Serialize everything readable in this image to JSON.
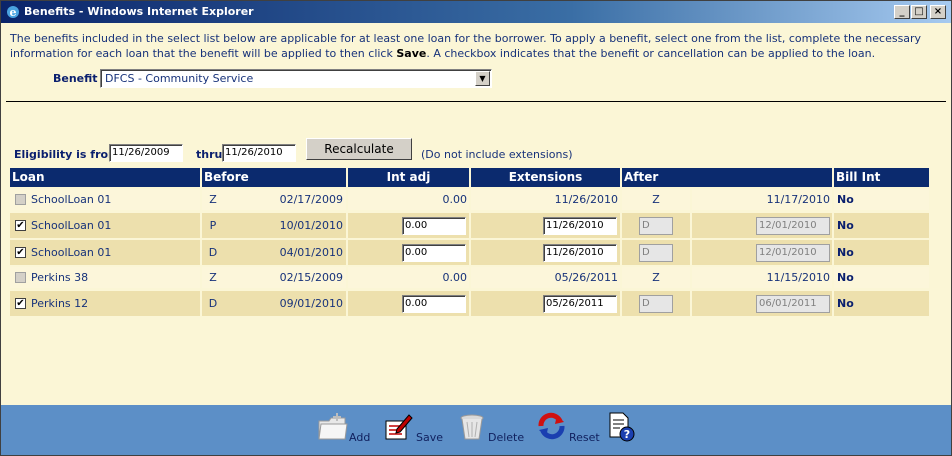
{
  "window": {
    "title": "Benefits - Windows Internet Explorer"
  },
  "intro": {
    "text_before": "The benefits included in the select list below are applicable for at least one loan for the borrower. To apply a benefit, select one from the list, complete the necessary information for each loan that the benefit will be applied to then click ",
    "save_word": "Save",
    "text_after": ". A checkbox indicates that the benefit or cancellation can be applied to the loan."
  },
  "benefit": {
    "label": "Benefit",
    "selected": "DFCS - Community Service"
  },
  "eligibility": {
    "label": "Eligibility is from",
    "from": "11/26/2009",
    "thru_label": "thru",
    "thru": "11/26/2010",
    "recalc_label": "Recalculate",
    "note": "(Do not include extensions)"
  },
  "headers": {
    "loan": "Loan",
    "before": "Before",
    "int_adj": "Int adj",
    "extensions": "Extensions",
    "after": "After",
    "bill_int": "Bill Int"
  },
  "rows": [
    {
      "checked": false,
      "enabled": false,
      "loan": "SchoolLoan 01",
      "before_code": "Z",
      "before_date": "02/17/2009",
      "int_adj": "0.00",
      "extension": "11/26/2010",
      "after_code": "Z",
      "after_date": "11/17/2010",
      "bill_int": "No",
      "editable": false
    },
    {
      "checked": true,
      "enabled": true,
      "loan": "SchoolLoan 01",
      "before_code": "P",
      "before_date": "10/01/2010",
      "int_adj": "0.00",
      "extension": "11/26/2010",
      "after_code": "D",
      "after_date": "12/01/2010",
      "bill_int": "No",
      "editable": true
    },
    {
      "checked": true,
      "enabled": true,
      "loan": "SchoolLoan 01",
      "before_code": "D",
      "before_date": "04/01/2010",
      "int_adj": "0.00",
      "extension": "11/26/2010",
      "after_code": "D",
      "after_date": "12/01/2010",
      "bill_int": "No",
      "editable": true
    },
    {
      "checked": false,
      "enabled": false,
      "loan": "Perkins 38",
      "before_code": "Z",
      "before_date": "02/15/2009",
      "int_adj": "0.00",
      "extension": "05/26/2011",
      "after_code": "Z",
      "after_date": "11/15/2010",
      "bill_int": "No",
      "editable": false
    },
    {
      "checked": true,
      "enabled": true,
      "loan": "Perkins 12",
      "before_code": "D",
      "before_date": "09/01/2010",
      "int_adj": "0.00",
      "extension": "05/26/2011",
      "after_code": "D",
      "after_date": "06/01/2011",
      "bill_int": "No",
      "editable": true
    }
  ],
  "toolbar": {
    "add": "Add",
    "save": "Save",
    "delete": "Delete",
    "reset": "Reset"
  },
  "colors": {
    "header_bg": "#0b2a6e",
    "footer_bg": "#5c8fc7",
    "page_bg": "#fbf6d6"
  }
}
